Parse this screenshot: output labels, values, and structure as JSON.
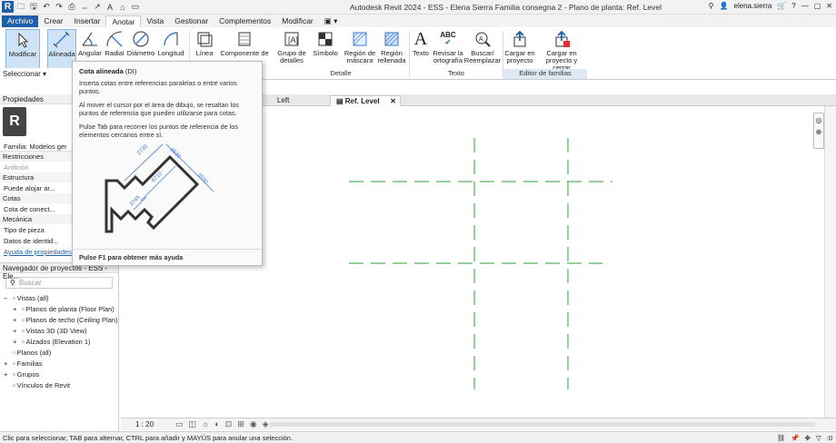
{
  "app": {
    "title": "Autodesk Revit 2024 - ESS - Elena Sierra Familia consegna 2 - Plano de planta: Ref. Level",
    "user": "elena.sierra",
    "logo": "R"
  },
  "ribbon_tabs": [
    "Archivo",
    "Crear",
    "Insertar",
    "Anotar",
    "Vista",
    "Gestionar",
    "Complementos",
    "Modificar",
    "▣ ▾"
  ],
  "ribbon": {
    "modificar": "Modificar",
    "alineada": "Alineada",
    "angular": "Angular",
    "radial": "Radial",
    "diametro": "Diámetro",
    "longitud": "Longitud",
    "linea": "Línea",
    "componente": "Componente de",
    "grupo": "Grupo de detalles",
    "simbolo": "Símbolo",
    "region_mascara": "Región de máscara",
    "region_rellenada": "Región rellenada",
    "texto": "Texto",
    "revisar": "Revisar la ortografía",
    "buscar": "Buscar/ Reemplazar",
    "cargar_proyecto": "Cargar en proyecto",
    "cargar_cerrar": "Cargar en proyecto y cerrar",
    "panel_detalle": "Detalle",
    "panel_texto": "Texto",
    "panel_editor": "Editor de familias",
    "seleccionar": "Seleccionar ▾"
  },
  "tooltip": {
    "title": "Cota alineada",
    "shortcut": "(DI)",
    "p1": "Inserta cotas entre referencias paralelas o entre varios puntos.",
    "p2": "Al mover el cursor por el área de dibujo, se resaltan los puntos de referencia que pueden utilizarse para cotas.",
    "p3": "Pulse Tab para recorrer los puntos de referencia de los elementos cercanos entre sí.",
    "footer": "Pulse F1 para obtener más ayuda",
    "dims": [
      "2730",
      "3530",
      "6710",
      "2745",
      "3530"
    ]
  },
  "properties": {
    "header": "Propiedades",
    "family": "Familia: Modelos ger",
    "rows": [
      {
        "type": "cat",
        "label": "Restricciones"
      },
      {
        "type": "row",
        "label": "Anfitrión",
        "value": ""
      },
      {
        "type": "cat",
        "label": "Estructura"
      },
      {
        "type": "row",
        "label": "Puede alojar ar...",
        "value": ""
      },
      {
        "type": "cat",
        "label": "Cotas"
      },
      {
        "type": "row",
        "label": "Cota de conect...",
        "value": "Usar c"
      },
      {
        "type": "cat",
        "label": "Mecánica"
      },
      {
        "type": "row",
        "label": "Tipo de pieza",
        "value": "Norm"
      },
      {
        "type": "row",
        "label": "Datos de identid...",
        "value": ""
      }
    ],
    "help_link": "Ayuda de propiedades"
  },
  "browser": {
    "header": "Navegador de proyectos - ESS - Ele...",
    "search_placeholder": "Buscar",
    "items": [
      {
        "label": "Vistas (all)",
        "indent": 0,
        "toggle": "−"
      },
      {
        "label": "Planos de planta (Floor Plan)",
        "indent": 1,
        "toggle": "+"
      },
      {
        "label": "Planos de techo (Ceiling Plan)",
        "indent": 1,
        "toggle": "+"
      },
      {
        "label": "Vistas 3D (3D View)",
        "indent": 1,
        "toggle": "+"
      },
      {
        "label": "Alzados (Elevation 1)",
        "indent": 1,
        "toggle": "+"
      },
      {
        "label": "Planos (all)",
        "indent": 0,
        "toggle": ""
      },
      {
        "label": "Familias",
        "indent": 0,
        "toggle": "+"
      },
      {
        "label": "Grupos",
        "indent": 0,
        "toggle": "+"
      },
      {
        "label": "Vínculos de Revit",
        "indent": 0,
        "toggle": ""
      }
    ]
  },
  "view_tabs": [
    "Left",
    "Ref. Level"
  ],
  "view_bar": {
    "scale": "1 : 20"
  },
  "status": {
    "text": "Clic para seleccionar, TAB para alternar, CTRL para añadir y MAYÚS para anular una selección.",
    "filter_count": ":0"
  },
  "colors": {
    "accent": "#1f5fa8",
    "ref_plane": "#2ca02c",
    "dim": "#3a78d8"
  }
}
